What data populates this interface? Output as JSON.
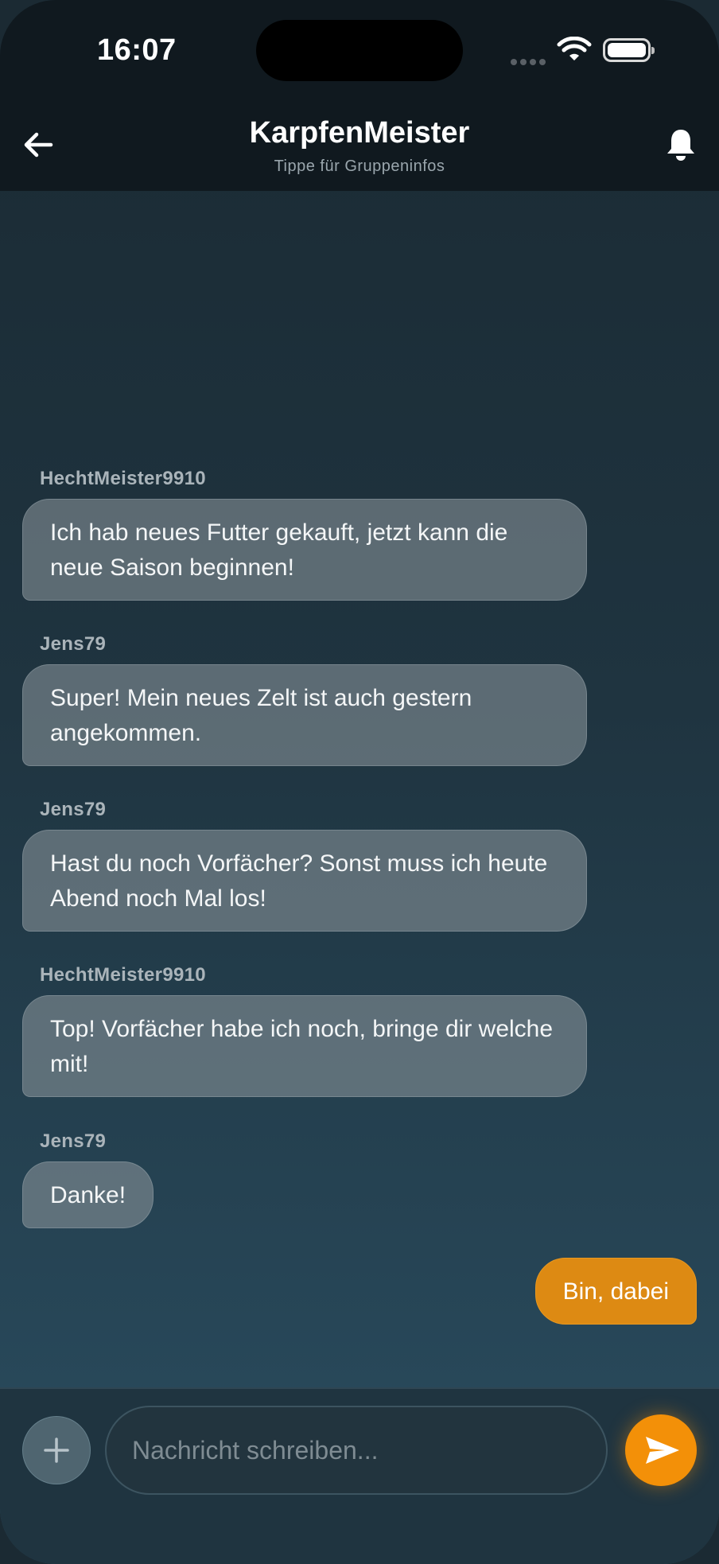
{
  "status_bar": {
    "time": "16:07"
  },
  "header": {
    "title": "KarpfenMeister",
    "subtitle": "Tippe für Gruppeninfos"
  },
  "messages": [
    {
      "sender": "HechtMeister9910",
      "text": "Ich hab neues Futter gekauft, jetzt kann die neue Saison beginnen!"
    },
    {
      "sender": "Jens79",
      "text": "Super! Mein neues Zelt ist auch gestern angekommen."
    },
    {
      "sender": "Jens79",
      "text": "Hast du noch Vorfächer? Sonst muss ich heute Abend noch Mal los!"
    },
    {
      "sender": "HechtMeister9910",
      "text": "Top! Vorfächer habe ich noch, bringe dir welche mit!"
    },
    {
      "sender": "Jens79",
      "text": "Danke!"
    }
  ],
  "own_message": {
    "text": "Bin, dabei"
  },
  "composer": {
    "placeholder": "Nachricht schreiben..."
  },
  "colors": {
    "accent": "#f39008",
    "own_bubble": "#dd8a13",
    "incoming_bubble": "#6f7c83",
    "header_bg": "#10191f"
  },
  "icons": {
    "back": "arrow-left-icon",
    "notifications": "bell-icon",
    "attach": "plus-icon",
    "send": "send-icon",
    "wifi": "wifi-icon",
    "battery": "battery-icon",
    "signal": "signal-icon"
  }
}
